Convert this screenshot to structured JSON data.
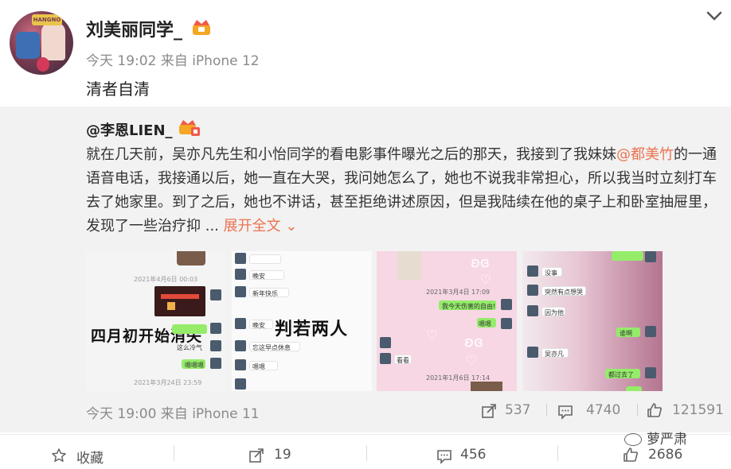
{
  "post": {
    "author": "刘美丽同学_",
    "meta": "今天 19:02 来自 iPhone 12",
    "text": "清者自清",
    "avatar_text": "HANGNO"
  },
  "repost": {
    "author": "@李恩LIEN_",
    "body_part1": "就在几天前，吴亦凡先生和小怡同学的看电影事件曝光之后的那天，我接到了我妹妹",
    "mention": "@都美竹",
    "body_part2": "的一通语音电话，我接通以后，她一直在大哭，我问她怎么了，她也不说我非常担心，所以我当时立刻打车去了她家里。到了之后，她也不讲话，甚至拒绝讲述原因，但是我陆续在他的桌子上和卧室抽屉里，发现了一些治疗抑 ...",
    "expand_label": "展开全文",
    "meta": "今天 19:00 来自 iPhone 11",
    "reposts": "537",
    "comments": "4740",
    "likes": "121591"
  },
  "thumbnails": {
    "t1_caption": "四月初开始消失",
    "t2_caption": "判若两人",
    "t4_line1": "没事",
    "t4_line2": "突然有点想哭",
    "t4_line3": "因为他",
    "t4_line4": "谁啊",
    "t4_line5": "吴亦凡",
    "t4_line6": "都过去了",
    "t3_line1": "我今天伤害的自由!",
    "t3_line2": "嗯嗯",
    "t3_line3": "看看",
    "t3_ts1": "2021年3月4日 17:09",
    "t3_ts2": "2021年1月6日 17:14",
    "t1_ts1": "2021年4月6日 00:03",
    "t1_ts2": "2021年3月24日 23:59",
    "t1_line1": "这么冷气",
    "t1_line2": "嗯嗯嗯",
    "t2_line1": "晚安",
    "t2_line2": "新年快乐",
    "t2_line3": "晚安",
    "t2_line4": "忘这早点休息",
    "t2_line5": "嗯嗯"
  },
  "actions": {
    "favorite_label": "收藏",
    "repost_count": "19",
    "comment_count": "456",
    "like_count": "2686"
  },
  "watermark": "萝严肃",
  "colors": {
    "accent": "#eb7350",
    "muted": "#8a8a8a",
    "repost_bg": "#f2f2f2"
  }
}
